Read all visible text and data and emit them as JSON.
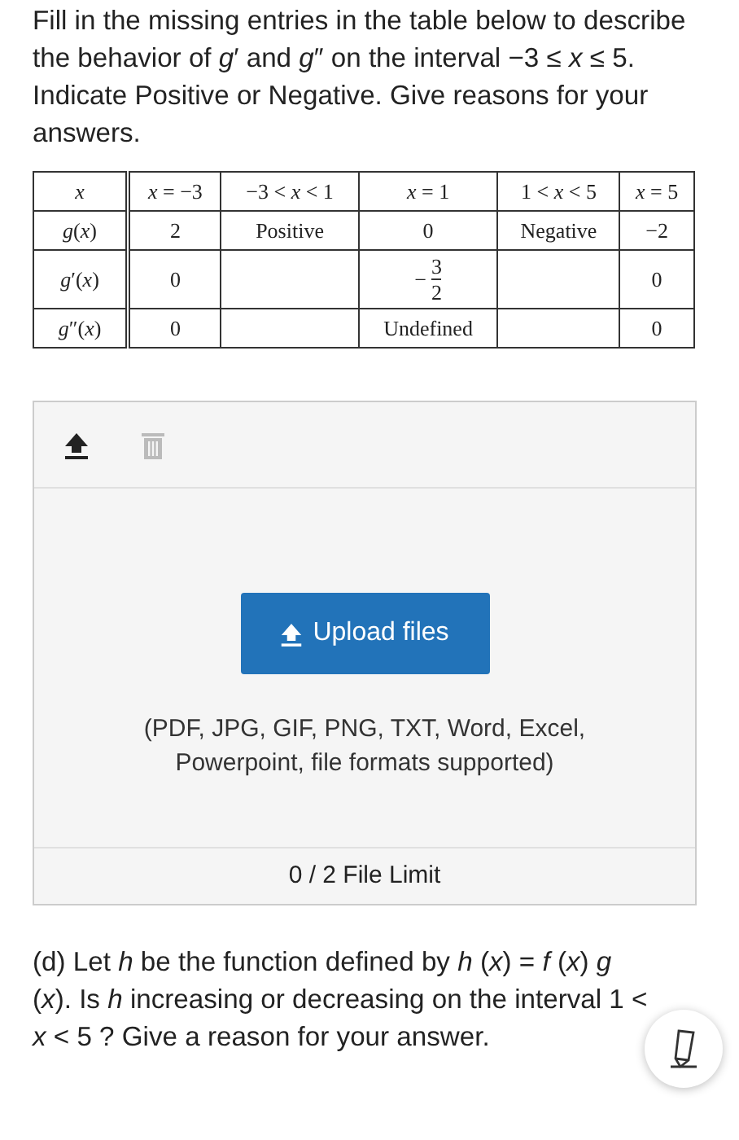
{
  "intro": "Fill in the missing entries in the table below to describe the behavior of *g*′ and *g*″ on the interval −3 ≤ *x* ≤ 5. Indicate Positive or Negative. Give reasons for your answers.",
  "table": {
    "columns": [
      "*x*",
      "*x* = −3",
      "−3 < *x* < 1",
      "*x* = 1",
      "1 < *x* < 5",
      "*x* = 5"
    ],
    "rows": [
      {
        "cells": [
          {
            "kind": "label",
            "text": "*g*(*x*)"
          },
          {
            "kind": "text",
            "text": "2"
          },
          {
            "kind": "text",
            "text": "Positive"
          },
          {
            "kind": "text",
            "text": "0"
          },
          {
            "kind": "text",
            "text": "Negative"
          },
          {
            "kind": "text",
            "text": "−2"
          }
        ]
      },
      {
        "cells": [
          {
            "kind": "label",
            "text": "*g*′(*x*)"
          },
          {
            "kind": "text",
            "text": "0"
          },
          {
            "kind": "empty"
          },
          {
            "kind": "fraction",
            "sign": "−",
            "numerator": "3",
            "denominator": "2"
          },
          {
            "kind": "empty"
          },
          {
            "kind": "text",
            "text": "0"
          }
        ]
      },
      {
        "cells": [
          {
            "kind": "label",
            "text": "*g*″(*x*)"
          },
          {
            "kind": "text",
            "text": "0"
          },
          {
            "kind": "empty"
          },
          {
            "kind": "text",
            "text": "Undefined"
          },
          {
            "kind": "empty"
          },
          {
            "kind": "text",
            "text": "0"
          }
        ]
      }
    ]
  },
  "upload": {
    "delete_enabled": false,
    "button": "Upload files",
    "note": "(PDF, JPG, GIF, PNG, TXT, Word, Excel, Powerpoint, file formats supported)",
    "limit": "0 / 2 File Limit"
  },
  "part_d": "(d)  Let *h* be the function defined by *h* (*x*) = *f* (*x*) *g* (*x*). Is *h* increasing or decreasing on the interval 1 < *x* < 5 ? Give a reason for your answer."
}
